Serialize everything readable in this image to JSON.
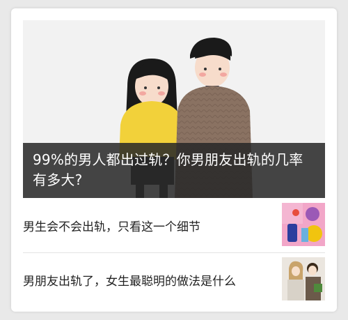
{
  "hero": {
    "title": "99%的男人都出过轨？你男朋友出轨的几率有多大?"
  },
  "articles": [
    {
      "title": "男生会不会出轨，只看这一个细节",
      "thumb_icon": "colorful-illustration-thumbnail"
    },
    {
      "title": "男朋友出轨了，女生最聪明的做法是什么",
      "thumb_icon": "couple-illustration-thumbnail"
    }
  ],
  "colors": {
    "overlay": "#282828",
    "card": "#ffffff",
    "background": "#e9e9e9",
    "text": "#222222"
  }
}
